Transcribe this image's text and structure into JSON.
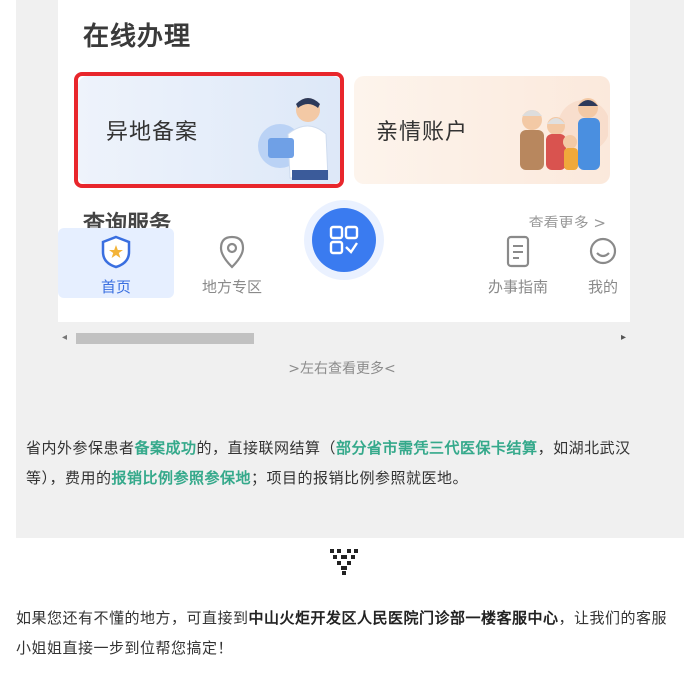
{
  "online": {
    "title": "在线办理",
    "cards": [
      {
        "label": "异地备案"
      },
      {
        "label": "亲情账户"
      }
    ],
    "query_title": "查询服务",
    "more_label": "查看更多 >"
  },
  "tabbar": {
    "items": [
      {
        "label": "首页"
      },
      {
        "label": "地方专区"
      },
      {
        "label": "办事指南"
      },
      {
        "label": "我的"
      }
    ]
  },
  "colors": {
    "accent": "#3a7bf0",
    "highlight": "#e8262c",
    "green": "#35a98b"
  },
  "scroll_hint": ">左右查看更多<",
  "paragraph1": {
    "t1": "省内外参保患者",
    "h1": "备案成功",
    "t2": "的，直接联网结算（",
    "h2": "部分省市需凭三代医保卡结算",
    "t3": "，如湖北武汉等），费用的",
    "h3": "报销比例参照参保地",
    "t4": "；项目的报销比例参照就医地。"
  },
  "paragraph2": {
    "t1": "如果您还有不懂的地方，可直接到",
    "b1": "中山火炬开发区人民医院门诊部一楼客服中心",
    "t2": "，让我们的客服小姐姐直接一步到位帮您搞定！"
  },
  "icons": [
    "shield-home-icon",
    "location-pin-icon",
    "grid-apps-icon",
    "document-icon",
    "profile-icon",
    "heart-pixel-icon"
  ]
}
